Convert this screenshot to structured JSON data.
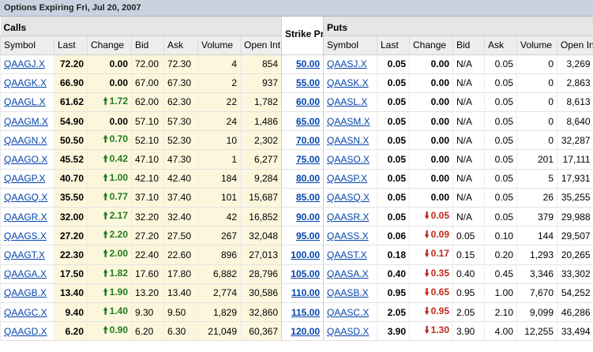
{
  "title": "Options Expiring Fri, Jul 20, 2007",
  "groups": {
    "calls": "Calls",
    "strike": "Strike Price",
    "puts": "Puts"
  },
  "columns": {
    "calls": [
      "Symbol",
      "Last",
      "Change",
      "Bid",
      "Ask",
      "Volume",
      "Open Int"
    ],
    "puts": [
      "Symbol",
      "Last",
      "Change",
      "Bid",
      "Ask",
      "Volume",
      "Open Int"
    ]
  },
  "colors": {
    "up": "#1f7a1f",
    "down": "#c0281c",
    "link": "#0645ad",
    "row_shade": "#fcf7dc"
  },
  "rows": [
    {
      "call": {
        "symbol": "QAAGJ.X",
        "last": "72.20",
        "change": "0.00",
        "dir": "none",
        "bid": "72.00",
        "ask": "72.30",
        "volume": "4",
        "open_int": "854"
      },
      "strike": "50.00",
      "put": {
        "symbol": "QAASJ.X",
        "last": "0.05",
        "change": "0.00",
        "dir": "none",
        "bid": "N/A",
        "ask": "0.05",
        "volume": "0",
        "open_int": "3,269"
      }
    },
    {
      "call": {
        "symbol": "QAAGK.X",
        "last": "66.90",
        "change": "0.00",
        "dir": "none",
        "bid": "67.00",
        "ask": "67.30",
        "volume": "2",
        "open_int": "937"
      },
      "strike": "55.00",
      "put": {
        "symbol": "QAASK.X",
        "last": "0.05",
        "change": "0.00",
        "dir": "none",
        "bid": "N/A",
        "ask": "0.05",
        "volume": "0",
        "open_int": "2,863"
      }
    },
    {
      "call": {
        "symbol": "QAAGL.X",
        "last": "61.62",
        "change": "1.72",
        "dir": "up",
        "bid": "62.00",
        "ask": "62.30",
        "volume": "22",
        "open_int": "1,782"
      },
      "strike": "60.00",
      "put": {
        "symbol": "QAASL.X",
        "last": "0.05",
        "change": "0.00",
        "dir": "none",
        "bid": "N/A",
        "ask": "0.05",
        "volume": "0",
        "open_int": "8,613"
      }
    },
    {
      "call": {
        "symbol": "QAAGM.X",
        "last": "54.90",
        "change": "0.00",
        "dir": "none",
        "bid": "57.10",
        "ask": "57.30",
        "volume": "24",
        "open_int": "1,486"
      },
      "strike": "65.00",
      "put": {
        "symbol": "QAASM.X",
        "last": "0.05",
        "change": "0.00",
        "dir": "none",
        "bid": "N/A",
        "ask": "0.05",
        "volume": "0",
        "open_int": "8,640"
      }
    },
    {
      "call": {
        "symbol": "QAAGN.X",
        "last": "50.50",
        "change": "0.70",
        "dir": "up",
        "bid": "52.10",
        "ask": "52.30",
        "volume": "10",
        "open_int": "2,302"
      },
      "strike": "70.00",
      "put": {
        "symbol": "QAASN.X",
        "last": "0.05",
        "change": "0.00",
        "dir": "none",
        "bid": "N/A",
        "ask": "0.05",
        "volume": "0",
        "open_int": "32,287"
      }
    },
    {
      "call": {
        "symbol": "QAAGO.X",
        "last": "45.52",
        "change": "0.42",
        "dir": "up",
        "bid": "47.10",
        "ask": "47.30",
        "volume": "1",
        "open_int": "6,277"
      },
      "strike": "75.00",
      "put": {
        "symbol": "QAASO.X",
        "last": "0.05",
        "change": "0.00",
        "dir": "none",
        "bid": "N/A",
        "ask": "0.05",
        "volume": "201",
        "open_int": "17,111"
      }
    },
    {
      "call": {
        "symbol": "QAAGP.X",
        "last": "40.70",
        "change": "1.00",
        "dir": "up",
        "bid": "42.10",
        "ask": "42.40",
        "volume": "184",
        "open_int": "9,284"
      },
      "strike": "80.00",
      "put": {
        "symbol": "QAASP.X",
        "last": "0.05",
        "change": "0.00",
        "dir": "none",
        "bid": "N/A",
        "ask": "0.05",
        "volume": "5",
        "open_int": "17,931"
      }
    },
    {
      "call": {
        "symbol": "QAAGQ.X",
        "last": "35.50",
        "change": "0.77",
        "dir": "up",
        "bid": "37.10",
        "ask": "37.40",
        "volume": "101",
        "open_int": "15,687"
      },
      "strike": "85.00",
      "put": {
        "symbol": "QAASQ.X",
        "last": "0.05",
        "change": "0.00",
        "dir": "none",
        "bid": "N/A",
        "ask": "0.05",
        "volume": "26",
        "open_int": "35,255"
      }
    },
    {
      "call": {
        "symbol": "QAAGR.X",
        "last": "32.00",
        "change": "2.17",
        "dir": "up",
        "bid": "32.20",
        "ask": "32.40",
        "volume": "42",
        "open_int": "16,852"
      },
      "strike": "90.00",
      "put": {
        "symbol": "QAASR.X",
        "last": "0.05",
        "change": "0.05",
        "dir": "down",
        "bid": "N/A",
        "ask": "0.05",
        "volume": "379",
        "open_int": "29,988"
      }
    },
    {
      "call": {
        "symbol": "QAAGS.X",
        "last": "27.20",
        "change": "2.20",
        "dir": "up",
        "bid": "27.20",
        "ask": "27.50",
        "volume": "267",
        "open_int": "32,048"
      },
      "strike": "95.00",
      "put": {
        "symbol": "QAASS.X",
        "last": "0.06",
        "change": "0.09",
        "dir": "down",
        "bid": "0.05",
        "ask": "0.10",
        "volume": "144",
        "open_int": "29,507"
      }
    },
    {
      "call": {
        "symbol": "QAAGT.X",
        "last": "22.30",
        "change": "2.00",
        "dir": "up",
        "bid": "22.40",
        "ask": "22.60",
        "volume": "896",
        "open_int": "27,013"
      },
      "strike": "100.00",
      "put": {
        "symbol": "QAAST.X",
        "last": "0.18",
        "change": "0.17",
        "dir": "down",
        "bid": "0.15",
        "ask": "0.20",
        "volume": "1,293",
        "open_int": "20,265"
      }
    },
    {
      "call": {
        "symbol": "QAAGA.X",
        "last": "17.50",
        "change": "1.82",
        "dir": "up",
        "bid": "17.60",
        "ask": "17.80",
        "volume": "6,882",
        "open_int": "28,796"
      },
      "strike": "105.00",
      "put": {
        "symbol": "QAASA.X",
        "last": "0.40",
        "change": "0.35",
        "dir": "down",
        "bid": "0.40",
        "ask": "0.45",
        "volume": "3,346",
        "open_int": "33,302"
      }
    },
    {
      "call": {
        "symbol": "QAAGB.X",
        "last": "13.40",
        "change": "1.90",
        "dir": "up",
        "bid": "13.20",
        "ask": "13.40",
        "volume": "2,774",
        "open_int": "30,586"
      },
      "strike": "110.00",
      "put": {
        "symbol": "QAASB.X",
        "last": "0.95",
        "change": "0.65",
        "dir": "down",
        "bid": "0.95",
        "ask": "1.00",
        "volume": "7,670",
        "open_int": "54,252"
      }
    },
    {
      "call": {
        "symbol": "QAAGC.X",
        "last": "9.40",
        "change": "1.40",
        "dir": "up",
        "bid": "9.30",
        "ask": "9.50",
        "volume": "1,829",
        "open_int": "32,860"
      },
      "strike": "115.00",
      "put": {
        "symbol": "QAASC.X",
        "last": "2.05",
        "change": "0.95",
        "dir": "down",
        "bid": "2.05",
        "ask": "2.10",
        "volume": "9,099",
        "open_int": "46,286"
      }
    },
    {
      "call": {
        "symbol": "QAAGD.X",
        "last": "6.20",
        "change": "0.90",
        "dir": "up",
        "bid": "6.20",
        "ask": "6.30",
        "volume": "21,049",
        "open_int": "60,367"
      },
      "strike": "120.00",
      "put": {
        "symbol": "QAASD.X",
        "last": "3.90",
        "change": "1.30",
        "dir": "down",
        "bid": "3.90",
        "ask": "4.00",
        "volume": "12,255",
        "open_int": "33,494"
      }
    }
  ]
}
